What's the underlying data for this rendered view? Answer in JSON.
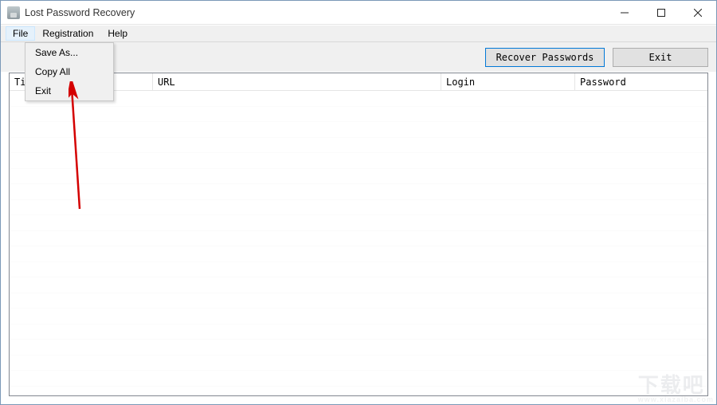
{
  "window": {
    "title": "Lost Password Recovery"
  },
  "menubar": {
    "items": [
      "File",
      "Registration",
      "Help"
    ]
  },
  "dropdown": {
    "items": [
      "Save As...",
      "Copy All",
      "Exit"
    ]
  },
  "toolbar": {
    "recover_label": "Recover Passwords",
    "exit_label": "Exit"
  },
  "columns": {
    "title": "Title",
    "url": "URL",
    "login": "Login",
    "password": "Password"
  },
  "watermark": {
    "main": "下载吧",
    "sub": "www.xiazaiba.com"
  }
}
